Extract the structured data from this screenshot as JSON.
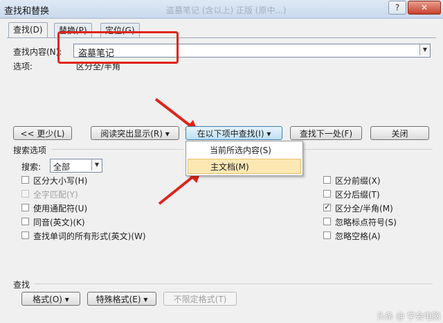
{
  "window": {
    "title": "查找和替换",
    "faded_title": "盗墓笔记 (含以上) 正版 (原中...)",
    "help_button": "?",
    "close_button": "✕"
  },
  "tabs": [
    {
      "label": "查找(D)",
      "active": true
    },
    {
      "label": "替换(P)",
      "active": false
    },
    {
      "label": "定位(G)",
      "active": false
    }
  ],
  "find": {
    "label": "查找内容(N):",
    "value": "盗墓笔记",
    "options_label": "选项:",
    "options_value": "区分全/半角"
  },
  "buttons": {
    "less": "<< 更少(L)",
    "reading_highlight": "阅读突出显示(R) ▾",
    "find_in": "在以下项中查找(I) ▾",
    "find_next": "查找下一处(F)",
    "close": "关闭"
  },
  "find_in_menu": {
    "items": [
      "当前所选内容(S)",
      "主文档(M)"
    ],
    "hovered_index": 1
  },
  "search_options": {
    "section_title": "搜索选项",
    "search_label": "搜索:",
    "search_value": "全部",
    "left": [
      {
        "label": "区分大小写(H)",
        "checked": false,
        "disabled": false
      },
      {
        "label": "全字匹配(Y)",
        "checked": false,
        "disabled": true
      },
      {
        "label": "使用通配符(U)",
        "checked": false,
        "disabled": false
      },
      {
        "label": "同音(英文)(K)",
        "checked": false,
        "disabled": false
      },
      {
        "label": "查找单词的所有形式(英文)(W)",
        "checked": false,
        "disabled": false
      }
    ],
    "right": [
      {
        "label": "区分前缀(X)",
        "checked": false,
        "disabled": false
      },
      {
        "label": "区分后缀(T)",
        "checked": false,
        "disabled": false
      },
      {
        "label": "区分全/半角(M)",
        "checked": true,
        "disabled": false
      },
      {
        "label": "忽略标点符号(S)",
        "checked": false,
        "disabled": false
      },
      {
        "label": "忽略空格(A)",
        "checked": false,
        "disabled": false
      }
    ]
  },
  "find_section": {
    "title": "查找",
    "format": "格式(O) ▾",
    "special": "特殊格式(E) ▾",
    "no_format": "不限定格式(T)"
  },
  "watermark": "头条 @ 学会电脑"
}
